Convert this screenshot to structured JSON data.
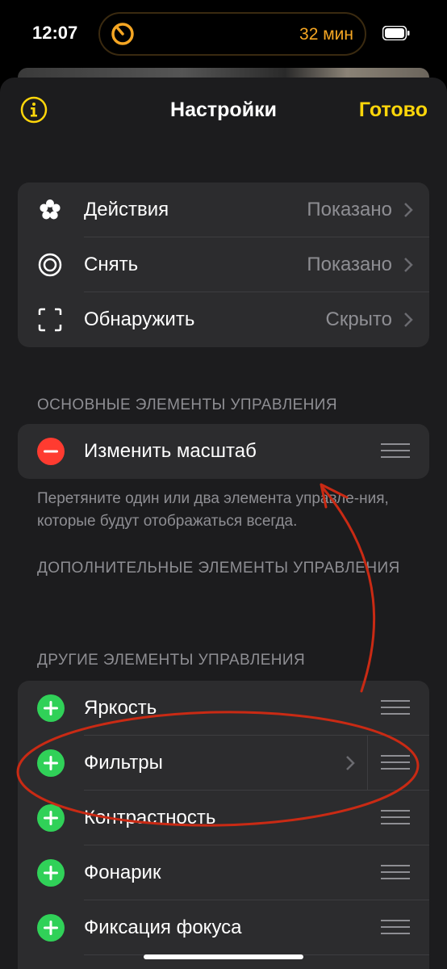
{
  "status_bar": {
    "time": "12:07",
    "timer": "32 мин"
  },
  "nav": {
    "title": "Настройки",
    "done": "Готово"
  },
  "modes": [
    {
      "label": "Действия",
      "value": "Показано",
      "icon": "flower-icon"
    },
    {
      "label": "Снять",
      "value": "Показано",
      "icon": "capture-icon"
    },
    {
      "label": "Обнаружить",
      "value": "Скрыто",
      "icon": "scan-frame-icon"
    }
  ],
  "primary": {
    "header": "ОСНОВНЫЕ ЭЛЕМЕНТЫ УПРАВЛЕНИЯ",
    "items": [
      {
        "label": "Изменить масштаб"
      }
    ],
    "footer": "Перетяните один или два элемента управле-ния, которые будут отображаться всегда."
  },
  "secondary": {
    "header": "ДОПОЛНИТЕЛЬНЫЕ ЭЛЕМЕНТЫ УПРАВЛЕНИЯ"
  },
  "other": {
    "header": "ДРУГИЕ ЭЛЕМЕНТЫ УПРАВЛЕНИЯ",
    "items": [
      {
        "label": "Яркость"
      },
      {
        "label": "Фильтры"
      },
      {
        "label": "Контрастность"
      },
      {
        "label": "Фонарик"
      },
      {
        "label": "Фиксация фокуса"
      }
    ]
  },
  "colors": {
    "accent": "#ffd60a",
    "remove": "#ff3b30",
    "add": "#30d158",
    "annotation": "#c92a14",
    "timer": "#f5a623"
  }
}
